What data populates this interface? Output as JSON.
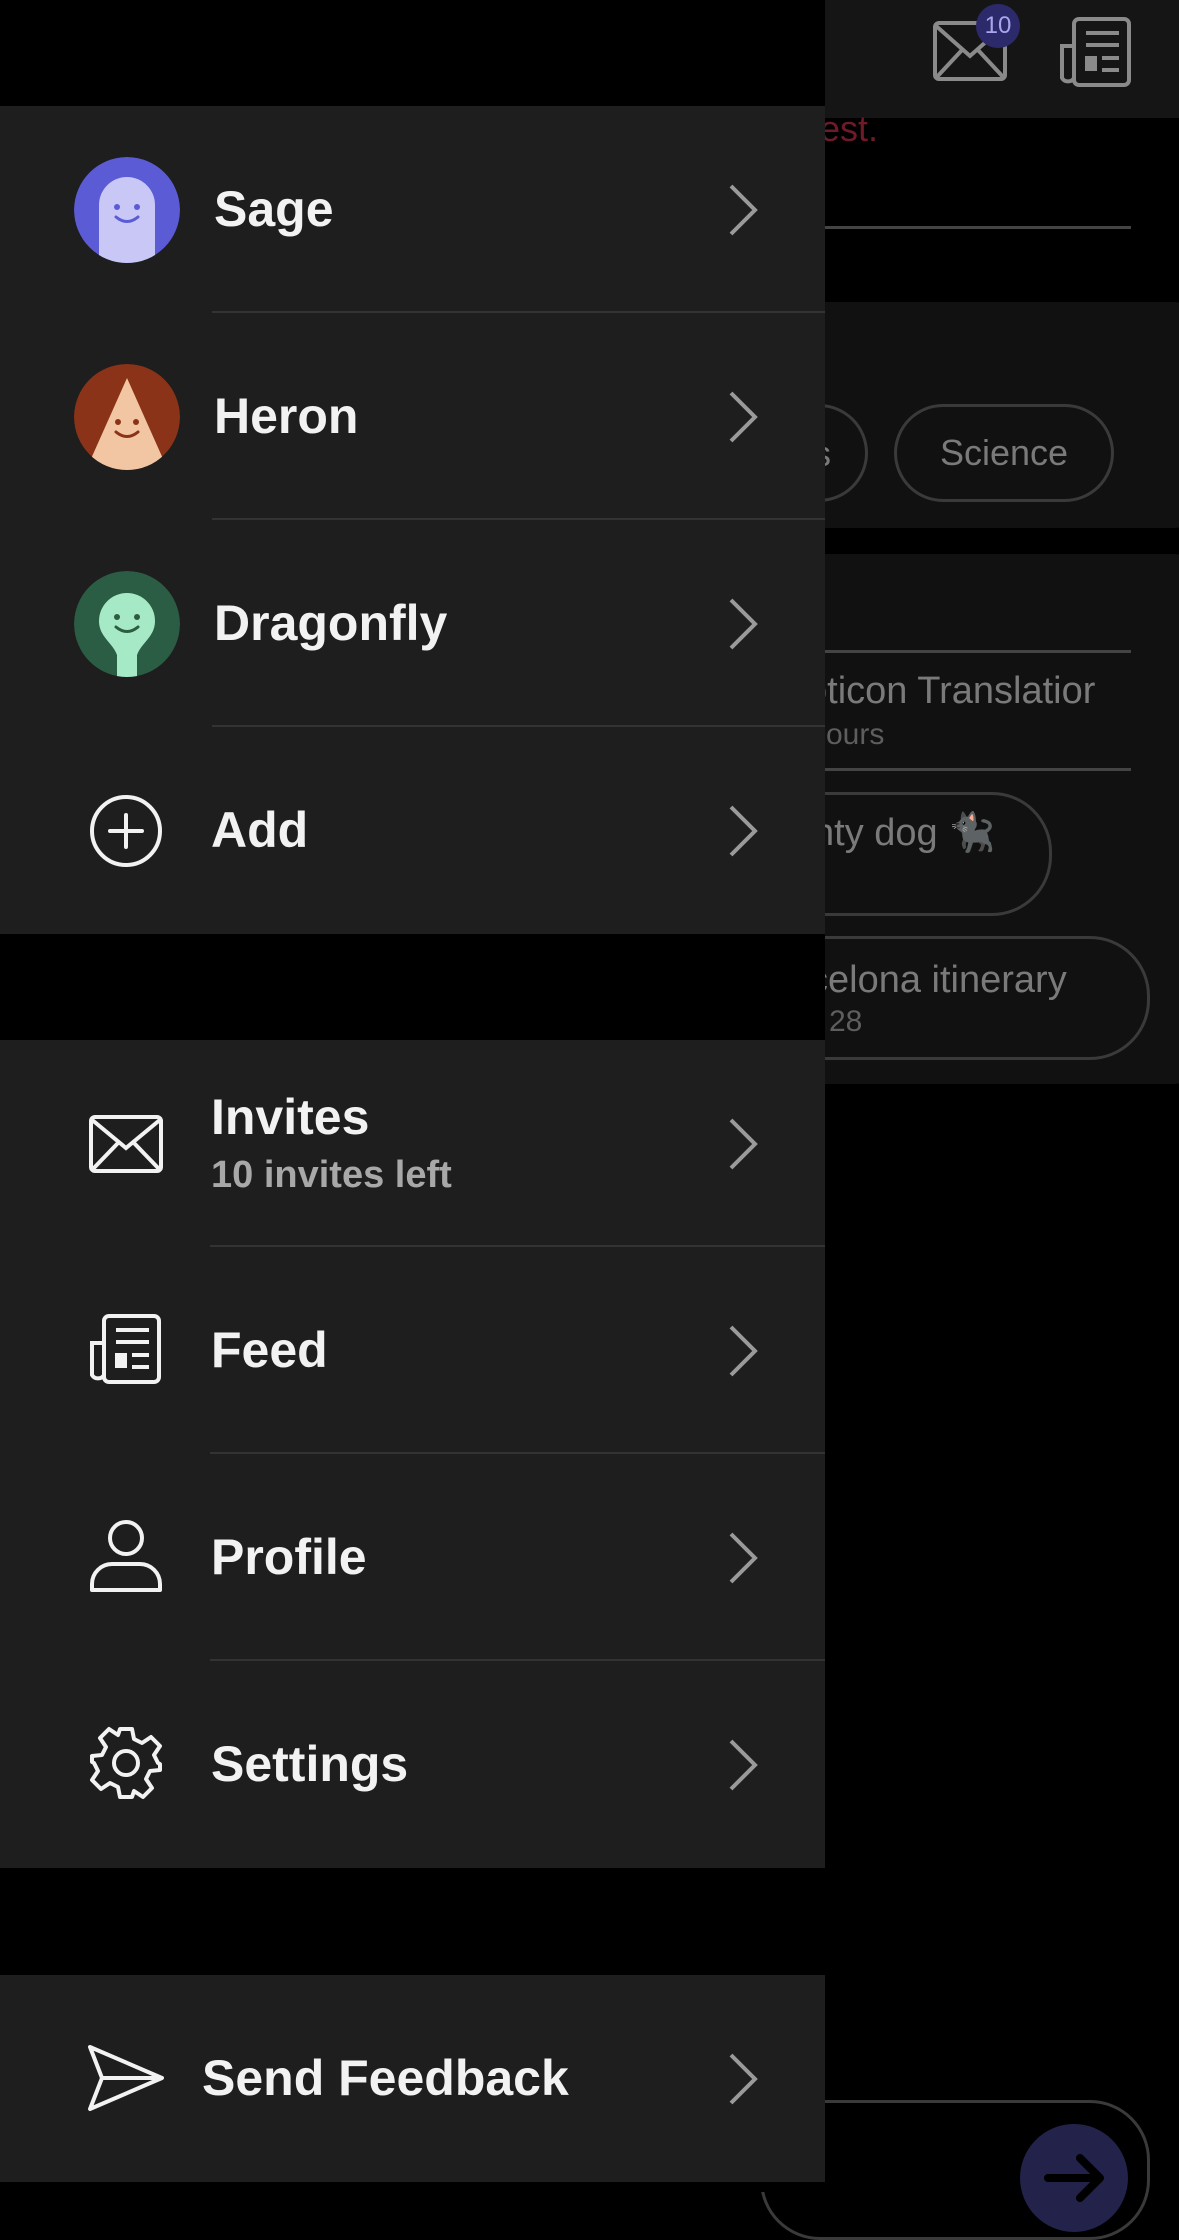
{
  "header": {
    "inbox_badge": "10"
  },
  "background": {
    "request_text": "uest.",
    "topic_science": "Science",
    "topic_partial": "s",
    "chat1_title": "oticon Translatior",
    "chat1_meta": "ours",
    "chat2_title": "nty dog 🐈‍⬛",
    "chat3_title": "celona itinerary",
    "chat3_meta": "28"
  },
  "drawer": {
    "personas": [
      {
        "name": "Sage",
        "color": "#5b5bd6",
        "face": "#c9c7f5"
      },
      {
        "name": "Heron",
        "color": "#8a3318",
        "face": "#f2c6a2"
      },
      {
        "name": "Dragonfly",
        "color": "#2b5c44",
        "face": "#a6e9c6"
      }
    ],
    "add_label": "Add",
    "menu": [
      {
        "label": "Invites",
        "sub": "10 invites left",
        "icon": "envelope-icon"
      },
      {
        "label": "Feed",
        "icon": "newspaper-icon"
      },
      {
        "label": "Profile",
        "icon": "person-icon"
      },
      {
        "label": "Settings",
        "icon": "gear-icon"
      }
    ],
    "feedback_label": "Send Feedback"
  }
}
